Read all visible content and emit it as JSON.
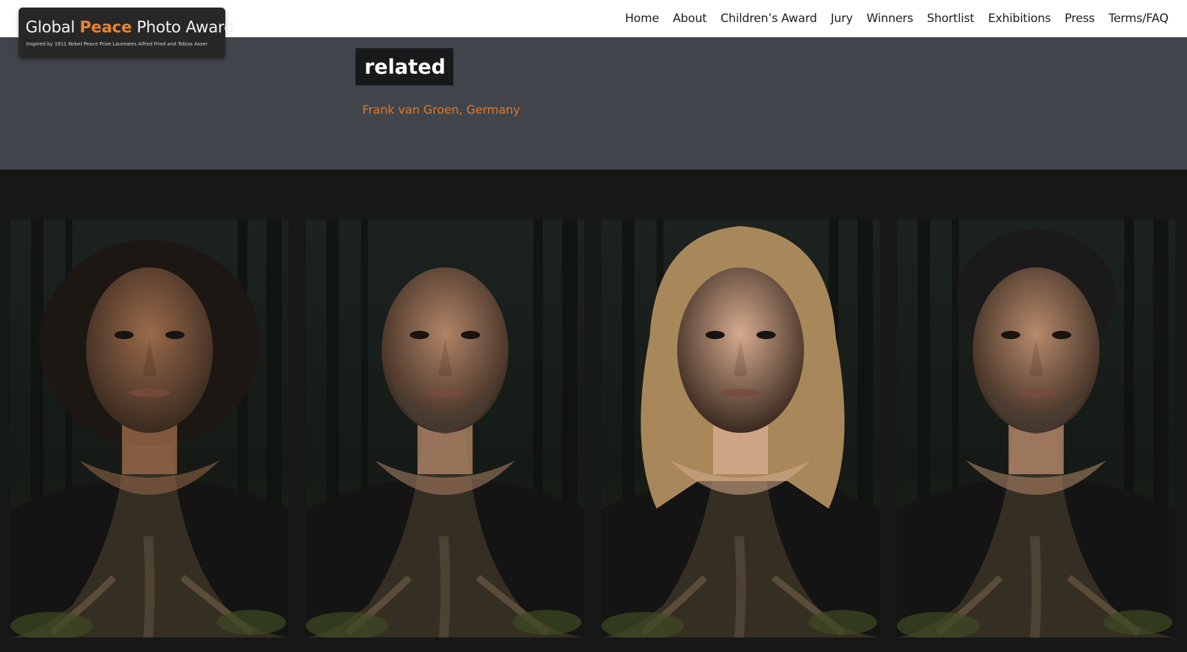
{
  "header": {
    "logo": {
      "title_part1": "Global",
      "title_accent": "Peace",
      "title_part2": "Photo Award",
      "subtitle": "Inspired by 1911 Nobel Peace Prize Laureates Alfred Fried and Tobias Asser"
    },
    "nav": [
      {
        "label": "Home"
      },
      {
        "label": "About"
      },
      {
        "label": "Children’s Award"
      },
      {
        "label": "Jury"
      },
      {
        "label": "Winners"
      },
      {
        "label": "Shortlist"
      },
      {
        "label": "Exhibitions"
      },
      {
        "label": "Press"
      },
      {
        "label": "Terms/FAQ"
      }
    ]
  },
  "hero": {
    "label": "related",
    "author": "Frank van Groen, Germany"
  },
  "gallery": {
    "photos": [
      {
        "skin": "#9a6a4a",
        "hair": "#1d1714",
        "hair_style": "curly-dark"
      },
      {
        "skin": "#b08467",
        "hair": "#b08467",
        "hair_style": "bald"
      },
      {
        "skin": "#d6ab8f",
        "hair": "#a8875a",
        "hair_style": "long-blonde"
      },
      {
        "skin": "#b78a6c",
        "hair": "#1b1a1a",
        "hair_style": "short-dark"
      }
    ]
  },
  "colors": {
    "accent": "#e8822e",
    "hero_bg": "#41444a",
    "page_bg": "#161717"
  }
}
